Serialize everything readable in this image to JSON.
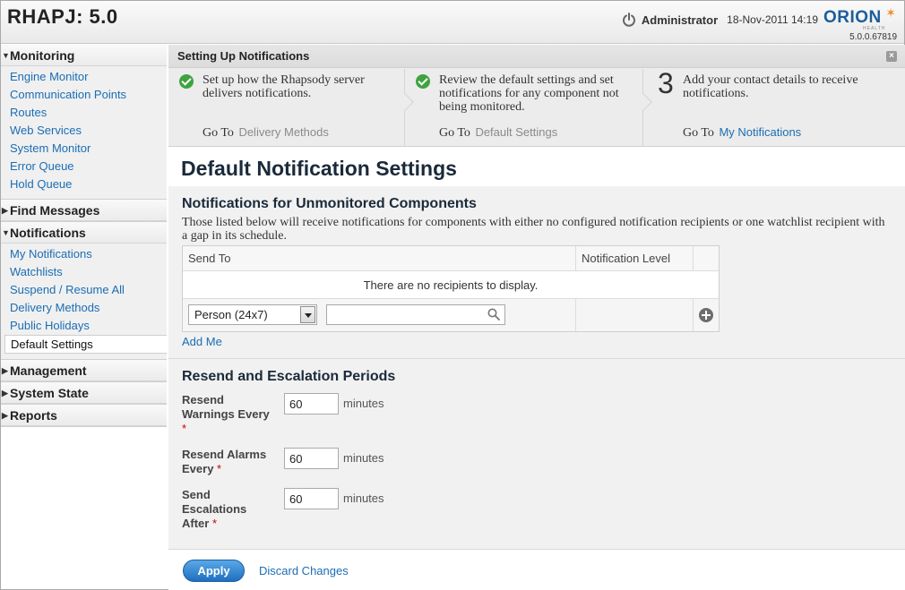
{
  "header": {
    "app_title": "RHAPJ: 5.0",
    "user": "Administrator",
    "datetime": "18-Nov-2011 14:19",
    "logo_text": "ORION",
    "logo_sub": "HEALTH",
    "version": "5.0.0.67819"
  },
  "sidebar": {
    "monitoring": {
      "label": "Monitoring",
      "items": [
        "Engine Monitor",
        "Communication Points",
        "Routes",
        "Web Services",
        "System Monitor",
        "Error Queue",
        "Hold Queue"
      ]
    },
    "find_messages": {
      "label": "Find Messages"
    },
    "notifications": {
      "label": "Notifications",
      "items": [
        "My Notifications",
        "Watchlists",
        "Suspend / Resume All",
        "Delivery Methods",
        "Public Holidays",
        "Default Settings"
      ],
      "active": "Default Settings"
    },
    "management": {
      "label": "Management"
    },
    "system_state": {
      "label": "System State"
    },
    "reports": {
      "label": "Reports"
    }
  },
  "wizard": {
    "title": "Setting Up Notifications",
    "goto_label": "Go To",
    "steps": [
      {
        "status": "done",
        "text": "Set up how the Rhapsody server delivers notifications.",
        "link": "Delivery Methods"
      },
      {
        "status": "done",
        "text": "Review the default settings and set notifications for any component not being monitored.",
        "link": "Default Settings"
      },
      {
        "status": "pending",
        "number": "3",
        "text": "Add your contact details to receive notifications.",
        "link": "My Notifications"
      }
    ]
  },
  "main": {
    "page_title": "Default Notification Settings",
    "unmonitored": {
      "title": "Notifications for Unmonitored Components",
      "description": "Those listed below will receive notifications for components with either no configured notification recipients or one watchlist recipient with a gap in its schedule.",
      "columns": [
        "Send To",
        "Notification Level"
      ],
      "empty_text": "There are no recipients to display.",
      "recipient_type": "Person (24x7)",
      "search_value": "",
      "add_me": "Add Me"
    },
    "resend": {
      "title": "Resend and Escalation Periods",
      "fields": [
        {
          "label": "Resend Warnings Every",
          "value": "60",
          "unit": "minutes"
        },
        {
          "label": "Resend Alarms Every",
          "value": "60",
          "unit": "minutes"
        },
        {
          "label": "Send Escalations After",
          "value": "60",
          "unit": "minutes"
        }
      ],
      "required_marker": "*"
    }
  },
  "footer": {
    "apply": "Apply",
    "discard": "Discard Changes"
  },
  "colors": {
    "link": "#1b6db4",
    "check": "#3fa33f",
    "apply": "#1f6fc0",
    "required": "#cc0000"
  }
}
